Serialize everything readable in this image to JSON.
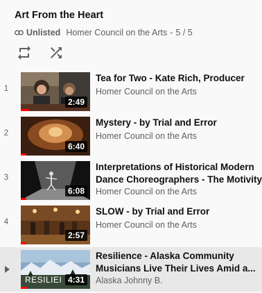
{
  "playlist": {
    "title": "Art From the Heart",
    "visibility": "Unlisted",
    "channel": "Homer Council on the Arts",
    "separator": "-",
    "position": "5 / 5"
  },
  "controls": {
    "loop_icon": "loop-icon",
    "shuffle_icon": "shuffle-icon"
  },
  "colors": {
    "progress": "#ff0000",
    "active_row": "#e8e8e8",
    "secondary_text": "#606060"
  },
  "videos": [
    {
      "index": "1",
      "title_lines": [
        "Tea for Two - Kate Rich, Producer"
      ],
      "channel": "Homer Council on the Arts",
      "duration": "2:49",
      "watched_fraction": 0.12
    },
    {
      "index": "2",
      "title_lines": [
        "Mystery - by Trial and Error"
      ],
      "channel": "Homer Council on the Arts",
      "duration": "6:40",
      "watched_fraction": 0.08
    },
    {
      "index": "3",
      "title_lines": [
        "Interpretations of Historical Modern",
        "Dance Choreographers - The Motivity..."
      ],
      "channel": "Homer Council on the Arts",
      "duration": "6:08",
      "watched_fraction": 0.08
    },
    {
      "index": "4",
      "title_lines": [
        "SLOW - by Trial and Error"
      ],
      "channel": "Homer Council on the Arts",
      "duration": "2:57",
      "watched_fraction": 0.08
    },
    {
      "index": "",
      "title_lines": [
        "Resilience - Alaska Community",
        "Musicians Live Their Lives Amid a..."
      ],
      "channel": "Alaska Johnny B.",
      "duration": "4:31",
      "thumb_text": "RESILIEI",
      "watched_fraction": 0.1,
      "now_playing": true
    }
  ]
}
